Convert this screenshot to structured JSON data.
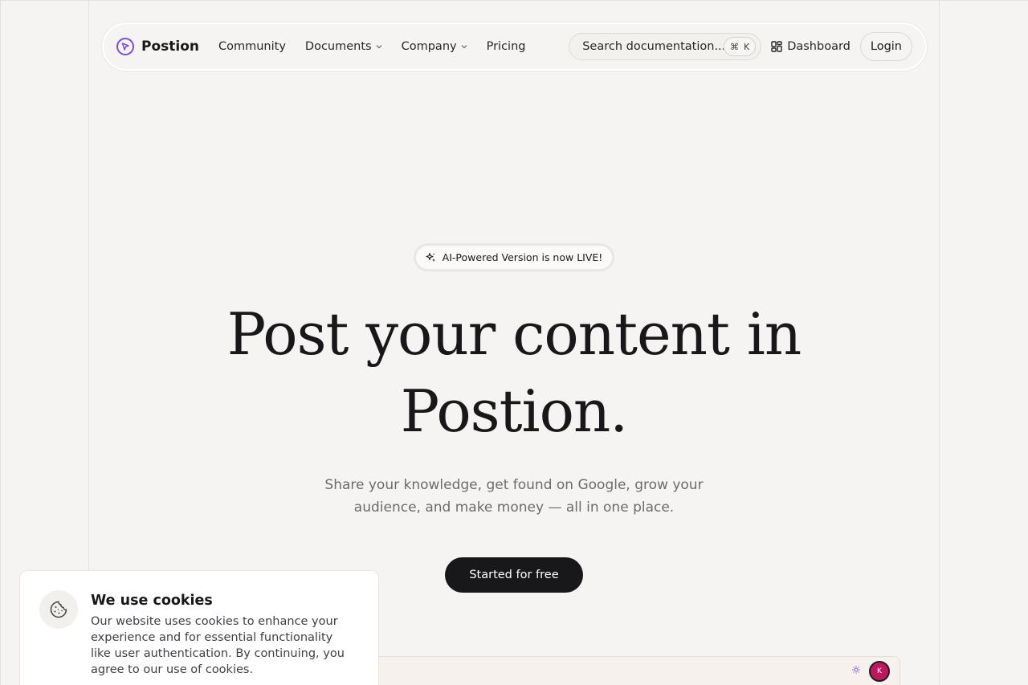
{
  "nav": {
    "brand": "Postion",
    "links": [
      {
        "label": "Community"
      },
      {
        "label": "Documents"
      },
      {
        "label": "Company"
      },
      {
        "label": "Pricing"
      }
    ],
    "search_label": "Search documentation...",
    "search_kbd_symbol": "⌘",
    "search_kbd_key": "K",
    "dashboard": "Dashboard",
    "login": "Login"
  },
  "hero": {
    "badge": "AI-Powered Version is now LIVE!",
    "title_line1": "Post your content in",
    "title_line2": "Postion.",
    "subtitle": "Share your knowledge, get found on Google, grow your audience, and make money — all in one place.",
    "cta": "Started for free"
  },
  "preview": {
    "avatar_initial": "K"
  },
  "cookie": {
    "title": "We use cookies",
    "text": "Our website uses cookies to enhance your experience and for essential functionality like user authentication. By continuing, you agree to our use of cookies."
  },
  "colors": {
    "background": "#f5f4f2",
    "brand_accent": "#7c4ddb",
    "cta_bg": "#18181b",
    "avatar_bg": "#be185d"
  }
}
